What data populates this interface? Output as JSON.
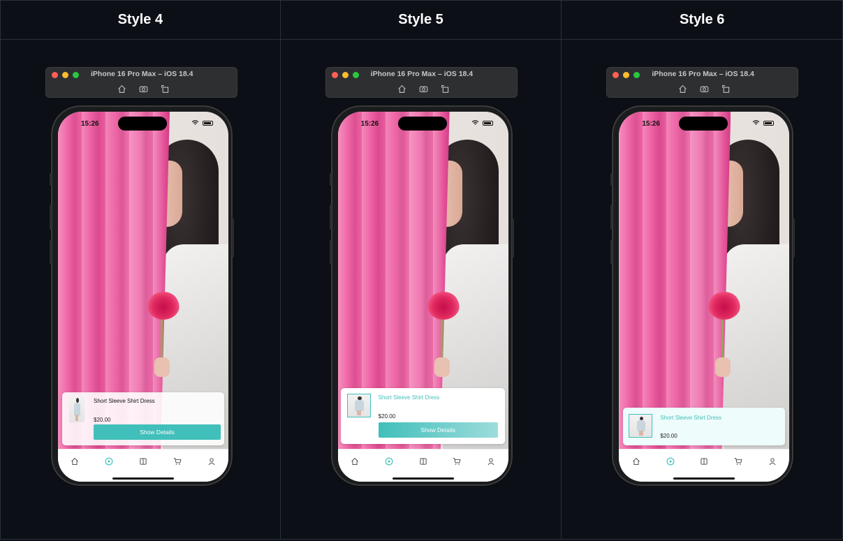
{
  "columns": [
    {
      "title": "Style 4",
      "simulator": {
        "title": "iPhone 16 Pro Max – iOS 18.4"
      },
      "status_time": "15:26",
      "product": {
        "name": "Short Sleeve Shirt Dress",
        "price": "$20.00",
        "button_label": "Show Details"
      }
    },
    {
      "title": "Style 5",
      "simulator": {
        "title": "iPhone 16 Pro Max – iOS 18.4"
      },
      "status_time": "15:26",
      "product": {
        "name": "Short Sleeve Shirt Dress",
        "price": "$20.00",
        "button_label": "Show Details"
      }
    },
    {
      "title": "Style 6",
      "simulator": {
        "title": "iPhone 16 Pro Max – iOS 18.4"
      },
      "status_time": "15:26",
      "product": {
        "name": "Short Sleeve Shirt Dress",
        "price": "$20.00"
      }
    }
  ],
  "simulator_icons": [
    "home-icon",
    "screenshot-icon",
    "rotate-icon"
  ],
  "tab_icons": [
    "home-icon",
    "play-icon",
    "book-icon",
    "cart-icon",
    "profile-icon"
  ],
  "colors": {
    "accent": "#3fbfba",
    "background": "#0c1016",
    "curtain": "#ec5b9f"
  }
}
